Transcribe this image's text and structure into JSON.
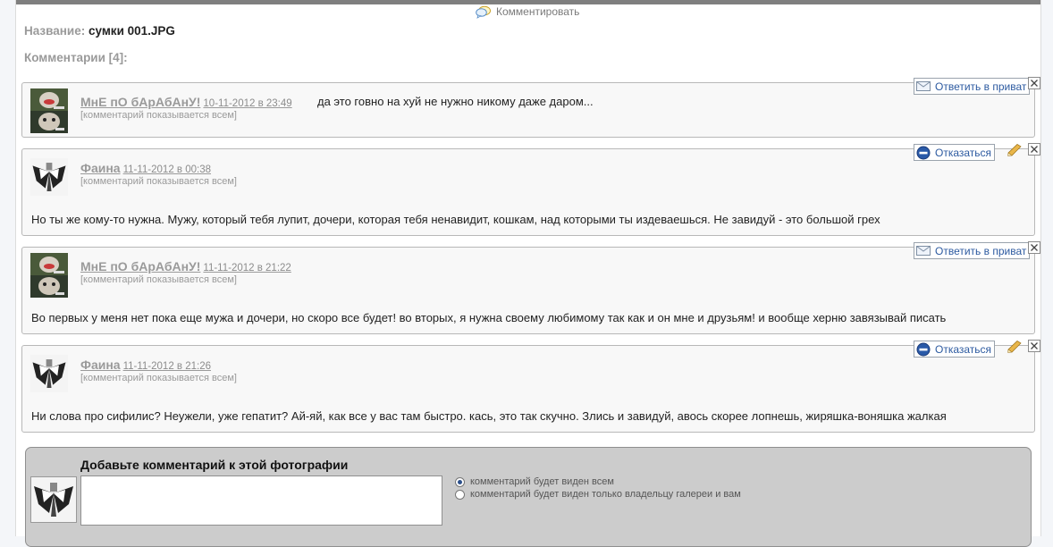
{
  "header": {
    "comment_link": "Комментировать",
    "name_label": "Название:",
    "name_value": "сумки 001.JPG",
    "comments_label": "Комментарии [4]:"
  },
  "comments": [
    {
      "author": "МнЕ пО бАрАбАнУ!",
      "date": "10-11-2012 в 23:49",
      "visibility": "[комментарий показывается всем]",
      "text": "да это говно на хуй не нужно никому даже даром...",
      "action": "Ответить в приват",
      "action_icon": "envelope-icon"
    },
    {
      "author": "Фаина",
      "date": "11-11-2012 в 00:38",
      "visibility": "[комментарий показывается всем]",
      "text": "Но ты же кому-то нужна. Мужу, который тебя лупит, дочери, которая тебя ненавидит, кошкам, над которыми ты издеваешься. Не завидуй - это большой грех",
      "action": "Отказаться",
      "action_icon": "no-entry-icon"
    },
    {
      "author": "МнЕ пО бАрАбАнУ!",
      "date": "11-11-2012 в 21:22",
      "visibility": "[комментарий показывается всем]",
      "text": "Во первых у меня нет пока еще мужа и дочери, но скоро все будет! во вторых, я нужна своему любимому так как и он мне и друзьям! и вообще херню завязывай писать",
      "action": "Ответить в приват",
      "action_icon": "envelope-icon"
    },
    {
      "author": "Фаина",
      "date": "11-11-2012 в 21:26",
      "visibility": "[комментарий показывается всем]",
      "text": "Ни слова про сифилис? Неужели, уже гепатит? Ай-яй, как все у вас там быстро. кась, это так скучно. Злись и завидуй, авось скорее лопнешь, жиряшка-воняшка жалкая",
      "action": "Отказаться",
      "action_icon": "no-entry-icon"
    }
  ],
  "add_comment": {
    "title": "Добавьте комментарий к этой фотографии",
    "textarea_value": "",
    "options": [
      {
        "label": "комментарий будет виден всем",
        "selected": true
      },
      {
        "label": "комментарий будет виден только владельцу галереи и вам",
        "selected": false
      }
    ]
  },
  "colors": {
    "link_blue": "#2c5aa0",
    "muted_gray": "#9a9a9a",
    "add_panel_bg": "#cccccc"
  }
}
